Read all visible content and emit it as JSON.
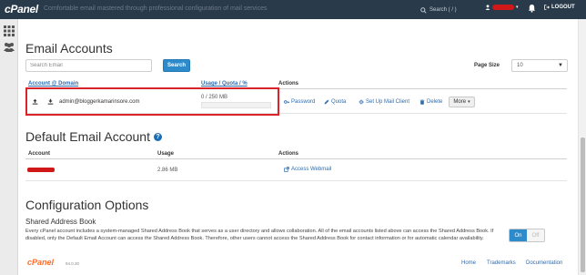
{
  "topbar": {
    "logo": "cPanel",
    "faded_text": "Comfortable email mastered through professional configuration of mail services",
    "search_placeholder": "Search ( / )",
    "logout": "LOGOUT"
  },
  "email_accounts": {
    "title": "Email Accounts",
    "search_placeholder": "Search Email",
    "search_button": "Search",
    "page_size_label": "Page Size",
    "page_size_value": "10",
    "columns": {
      "account": "Account @ Domain",
      "usage": "Usage / Quota / %",
      "actions": "Actions"
    },
    "rows": [
      {
        "email": "admin@bloggerkamarinsore.com",
        "usage": "0 / 250 MB",
        "usage_percent": 0
      }
    ],
    "actions": {
      "password": "Password",
      "quota": "Quota",
      "mail_client": "Set Up Mail Client",
      "delete": "Delete",
      "more": "More"
    }
  },
  "default_account": {
    "title": "Default Email Account",
    "columns": {
      "account": "Account",
      "usage": "Usage",
      "actions": "Actions"
    },
    "usage": "2.86 MB",
    "webmail": "Access Webmail"
  },
  "config": {
    "title": "Configuration Options",
    "subtitle": "Shared Address Book",
    "description": "Every cPanel account includes a system-managed Shared Address Book that serves as a user directory and allows collaboration. All of the email accounts listed above can access the Shared Address Book. If disabled, only the Default Email Account can access the Shared Address Book. Therefore, other users cannot access the Shared Address Book for contact information or for automatic calendar availability.",
    "toggle_on": "On",
    "toggle_off": "Off"
  },
  "footer": {
    "logo": "cPanel",
    "version": "94.0.30",
    "links": [
      "Home",
      "Trademarks",
      "Documentation"
    ]
  },
  "colors": {
    "topbar": "#293a4a",
    "accent_blue": "#2d8acb",
    "link": "#2d6cae",
    "highlight_red": "#d9222a",
    "footer_orange": "#ff6c2c"
  }
}
